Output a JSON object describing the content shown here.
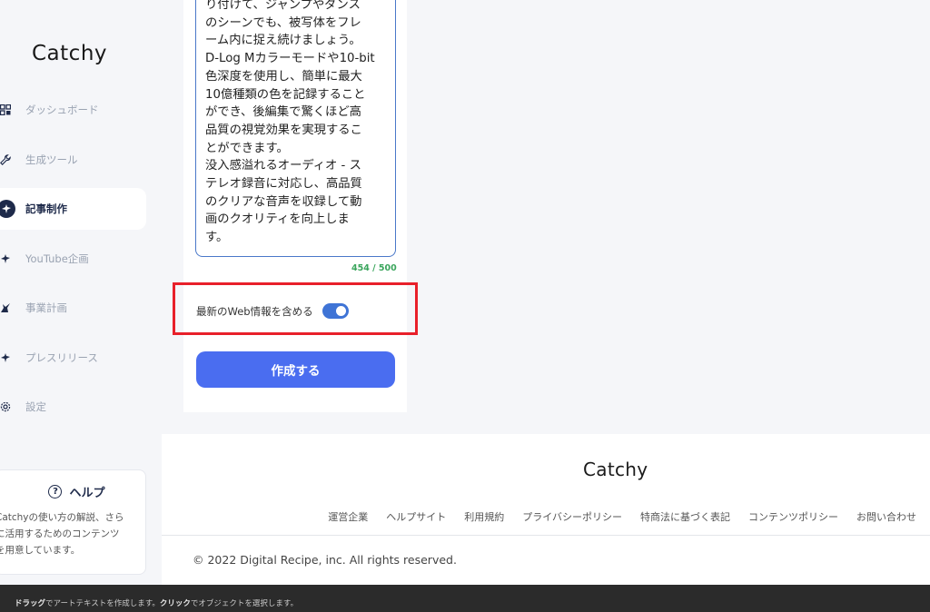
{
  "sidebar": {
    "logo": "Catchy",
    "items": [
      {
        "label": "ダッシュボード",
        "icon": "grid-icon"
      },
      {
        "label": "生成ツール",
        "icon": "wrench-icon"
      },
      {
        "label": "記事制作",
        "icon": "bird-icon",
        "active": true
      },
      {
        "label": "YouTube企画",
        "icon": "bird-icon"
      },
      {
        "label": "事業計画",
        "icon": "unicorn-icon"
      },
      {
        "label": "プレスリリース",
        "icon": "bird-icon"
      },
      {
        "label": "設定",
        "icon": "gear-icon"
      }
    ],
    "help": {
      "title": "ヘルプ",
      "text": "Catchyの使い方の解説、さら\nに活用するためのコンテンツ\nを用意しています。"
    }
  },
  "form": {
    "textarea_value": "り付けて、ジャンプやダンス\nのシーンでも、被写体をフレ\nーム内に捉え続けましょう。\nD-Log Mカラーモードや10-bit\n色深度を使用し、簡単に最大\n10億種類の色を記録すること\nができ、後編集で驚くほど高\n品質の視覚効果を実現するこ\nとができます。\n没入感溢れるオーディオ - ス\nテレオ録音に対応し、高品質\nのクリアな音声を収録して動\n画のクオリティを向上しま\nす。",
    "char_count": "454 / 500",
    "web_toggle_label": "最新のWeb情報を含める",
    "web_toggle_on": true,
    "create_button": "作成する"
  },
  "footer": {
    "logo": "Catchy",
    "links": [
      "運営企業",
      "ヘルプサイト",
      "利用規約",
      "プライバシーポリシー",
      "特商法に基づく表記",
      "コンテンツポリシー",
      "お問い合わせ"
    ],
    "copyright": "© 2022 Digital Recipe, inc. All rights reserved."
  },
  "status_bar": {
    "drag": "ドラッグ",
    "drag_desc": "でアートテキストを作成します。",
    "click": "クリック",
    "click_desc": "でオブジェクトを選択します。"
  },
  "colors": {
    "accent": "#4a6df0",
    "highlight": "#e8202a",
    "count": "#3aa55c",
    "nav_active": "#1e2a4a"
  }
}
